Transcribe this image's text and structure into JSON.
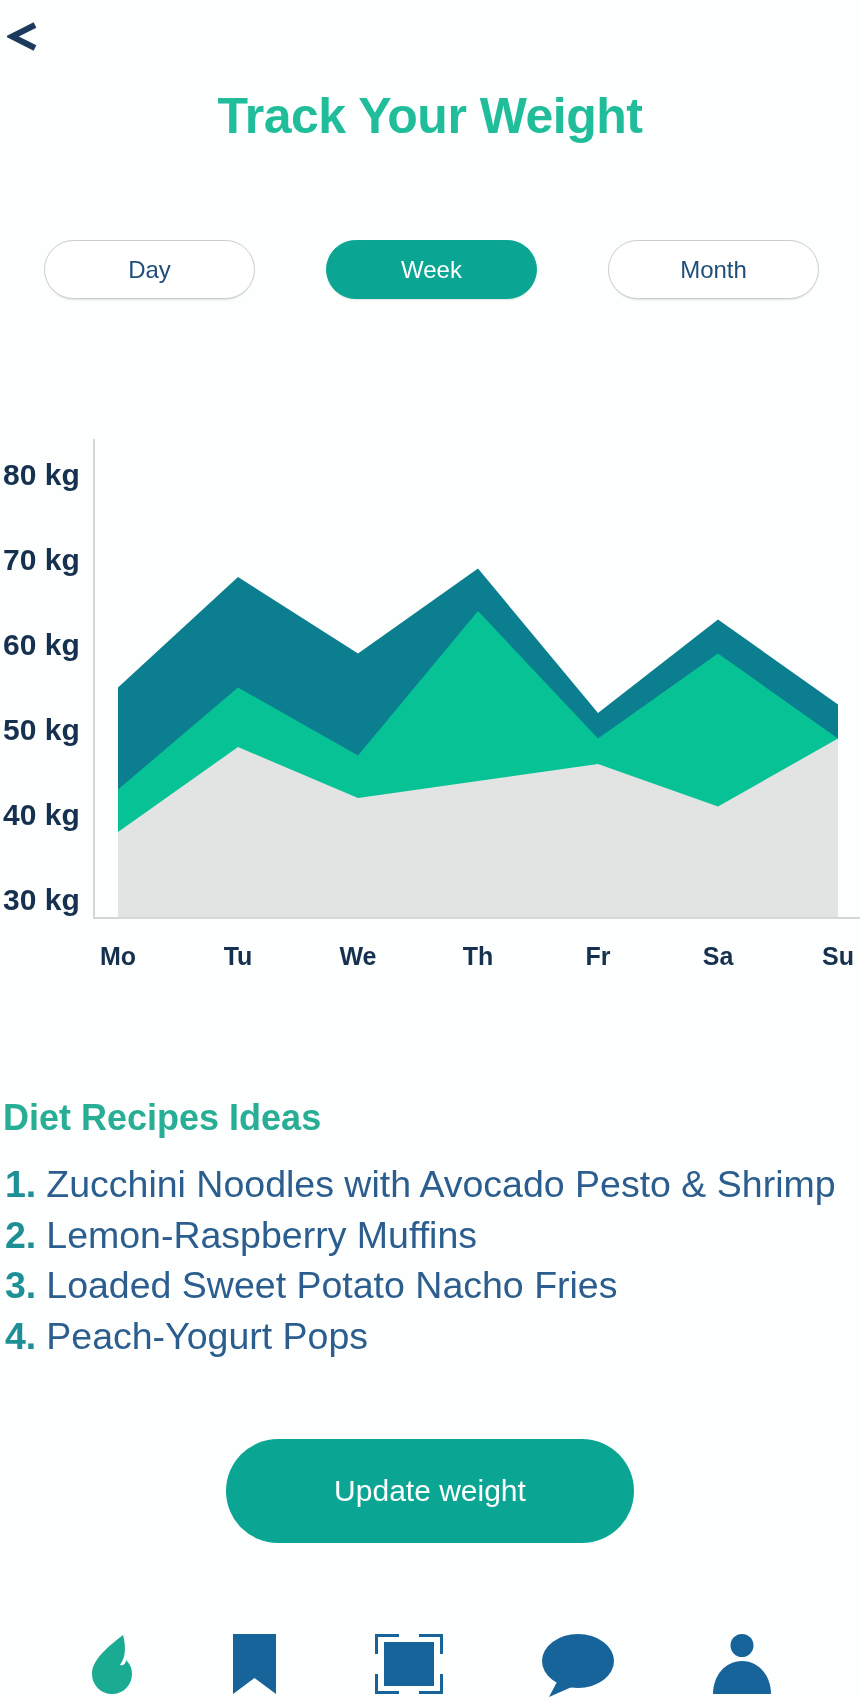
{
  "header": {
    "title": "Track Your Weight"
  },
  "tabs": [
    {
      "label": "Day",
      "selected": false
    },
    {
      "label": "Week",
      "selected": true
    },
    {
      "label": "Month",
      "selected": false
    }
  ],
  "weight_chart": {
    "chart_data": {
      "type": "area",
      "categories": [
        "Mo",
        "Tu",
        "We",
        "Th",
        "Fr",
        "Sa",
        "Su"
      ],
      "series": [
        {
          "color": "#e2e3e3",
          "values": [
            38,
            48,
            42,
            44,
            46,
            41,
            49
          ]
        },
        {
          "color": "#06c295",
          "values": [
            43,
            55,
            47,
            64,
            49,
            59,
            49
          ]
        },
        {
          "color": "#0b7f8f",
          "values": [
            55,
            68,
            59,
            69,
            52,
            63,
            53
          ]
        }
      ],
      "ylim": [
        28,
        84
      ],
      "yticks": [
        {
          "value": 80,
          "label": "80 kg"
        },
        {
          "value": 70,
          "label": "70 kg"
        },
        {
          "value": 60,
          "label": "60 kg"
        },
        {
          "value": 50,
          "label": "50 kg"
        },
        {
          "value": 40,
          "label": "40 kg"
        },
        {
          "value": 30,
          "label": "30 kg"
        }
      ]
    }
  },
  "recipes": {
    "title": "Diet Recipes Ideas",
    "items": [
      {
        "number": "1.",
        "name": "Zucchini Noodles with Avocado Pesto & Shrimp"
      },
      {
        "number": "2.",
        "name": "Lemon-Raspberry Muffins"
      },
      {
        "number": "3.",
        "name": "Loaded Sweet Potato Nacho Fries"
      },
      {
        "number": "4.",
        "name": "Peach-Yogurt Pops"
      }
    ]
  },
  "update_button": {
    "label": "Update weight"
  },
  "bottom_nav": [
    {
      "selected": true
    },
    {
      "selected": false
    },
    {
      "selected": false
    },
    {
      "selected": false
    },
    {
      "selected": false
    }
  ]
}
